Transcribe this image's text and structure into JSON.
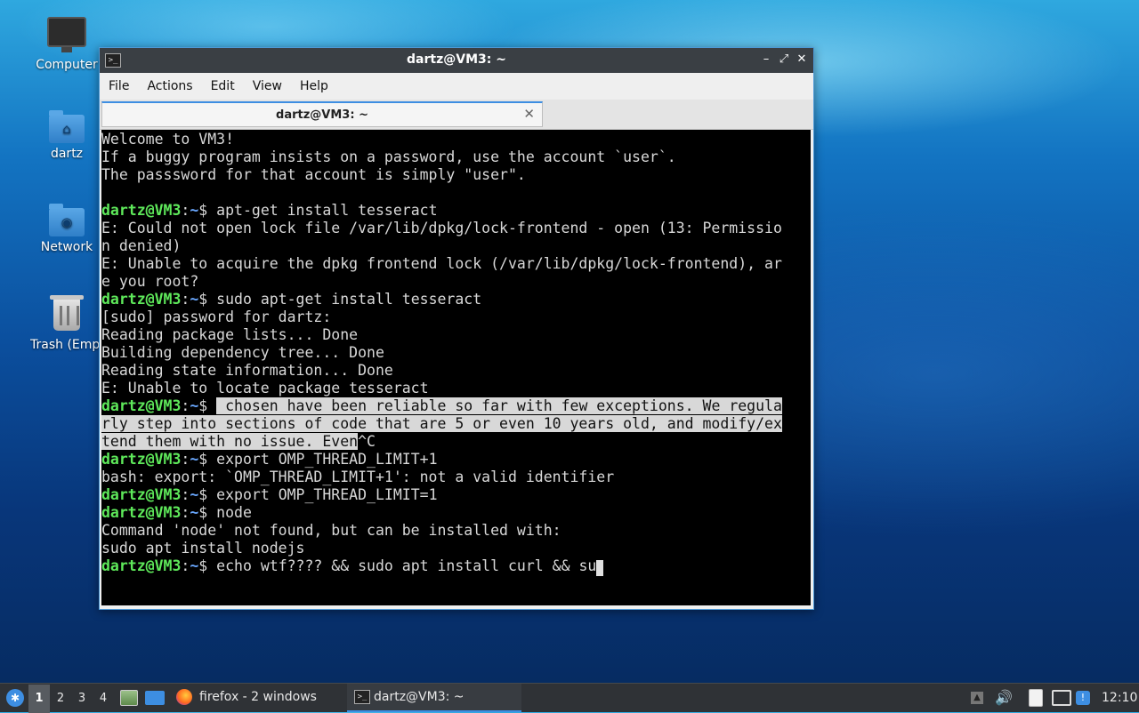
{
  "desktop": {
    "icons": [
      {
        "label": "Computer",
        "icon": "computer-icon"
      },
      {
        "label": "dartz",
        "icon": "home-folder-icon"
      },
      {
        "label": "Network",
        "icon": "network-folder-icon"
      },
      {
        "label": "Trash (Empty)",
        "icon": "trash-icon"
      }
    ]
  },
  "window": {
    "title": "dartz@VM3: ~",
    "controls": {
      "minimize": "–",
      "maximize": "⤢",
      "close": "✕"
    },
    "menu": [
      "File",
      "Actions",
      "Edit",
      "View",
      "Help"
    ],
    "tab": {
      "label": "dartz@VM3: ~",
      "close": "✕"
    }
  },
  "terminal": {
    "user": "dartz@VM3",
    "sep": ":",
    "path": "~",
    "dollar": "$ ",
    "lines": [
      {
        "t": "Welcome to VM3!"
      },
      {
        "t": "If a buggy program insists on a password, use the account `user`."
      },
      {
        "t": "The passsword for that account is simply \"user\"."
      },
      {
        "t": ""
      },
      {
        "prompt": true,
        "cmd": "apt-get install tesseract"
      },
      {
        "t": "E: Could not open lock file /var/lib/dpkg/lock-frontend - open (13: Permissio"
      },
      {
        "t": "n denied)"
      },
      {
        "t": "E: Unable to acquire the dpkg frontend lock (/var/lib/dpkg/lock-frontend), ar"
      },
      {
        "t": "e you root?"
      },
      {
        "prompt": true,
        "cmd": "sudo apt-get install tesseract"
      },
      {
        "t": "[sudo] password for dartz:"
      },
      {
        "t": "Reading package lists... Done"
      },
      {
        "t": "Building dependency tree... Done"
      },
      {
        "t": "Reading state information... Done"
      },
      {
        "t": "E: Unable to locate package tesseract"
      },
      {
        "prompt": true,
        "sel": " chosen have been reliable so far with few exceptions. We regula"
      },
      {
        "sel": "rly step into sections of code that are 5 or even 10 years old, and modify/ex"
      },
      {
        "sel": "tend them with no issue. Even",
        "t": "^C"
      },
      {
        "prompt": true,
        "cmd": "export OMP_THREAD_LIMIT+1"
      },
      {
        "t": "bash: export: `OMP_THREAD_LIMIT+1': not a valid identifier"
      },
      {
        "prompt": true,
        "cmd": "export OMP_THREAD_LIMIT=1"
      },
      {
        "prompt": true,
        "cmd": "node"
      },
      {
        "t": "Command 'node' not found, but can be installed with:"
      },
      {
        "t": "sudo apt install nodejs"
      },
      {
        "prompt": true,
        "cmd": "echo wtf???? && sudo apt install curl && su",
        "cursor": true
      }
    ]
  },
  "taskbar": {
    "workspaces": [
      "1",
      "2",
      "3",
      "4"
    ],
    "active_workspace": "1",
    "firefox_label": "firefox - 2 windows",
    "terminal_label": "dartz@VM3: ~",
    "clock": "12:10"
  }
}
